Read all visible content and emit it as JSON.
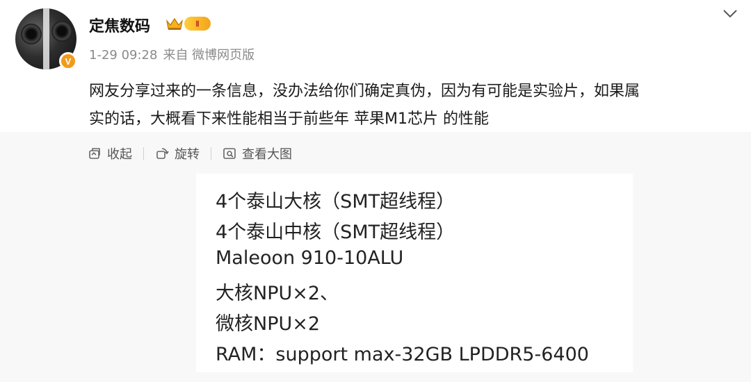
{
  "post": {
    "author": "定焦数码",
    "date": "1-29 09:28",
    "source": "来自 微博网页版",
    "verified_mark": "V",
    "vip_label": "Ⅱ",
    "text_line1": "网友分享过来的一条信息，没办法给你们确定真伪，因为有可能是实验片，如果属",
    "text_line2": "实的话，大概看下来性能相当于前些年 苹果M1芯片 的性能"
  },
  "actions": {
    "collapse": "收起",
    "rotate": "旋转",
    "view_large": "查看大图"
  },
  "image_text": {
    "lines": [
      "4个泰山大核（SMT超线程）",
      "4个泰山中核（SMT超线程）",
      "Maleoon 910-10ALU",
      "大核NPU×2、",
      "微核NPU×2",
      "RAM：support max-32GB LPDDR5-6400"
    ]
  },
  "icons": [
    "avatar",
    "verified-v-icon",
    "vip-crown-icon",
    "chevron-down-icon",
    "collapse-icon",
    "rotate-icon",
    "view-large-icon"
  ],
  "colors": {
    "accent": "#f29a1a",
    "meta": "#8a8a8a",
    "panel": "#f8f8f8"
  }
}
